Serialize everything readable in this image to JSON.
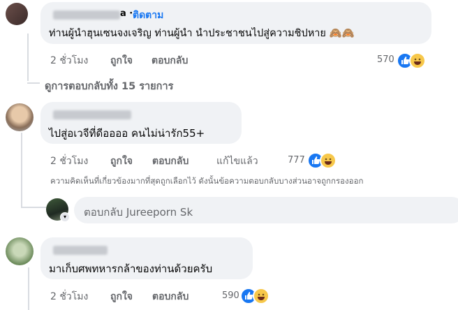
{
  "comments": [
    {
      "name_blurred": true,
      "follow_prefix": "a · ",
      "follow_label": "ติดตาม",
      "text": "ท่านผู้นำฮุนเซนจงเจริญ ท่านผู้นำ นำประชาชนไปสู่ความชิปหาย 🙈🙈",
      "time": "2 ชั่วโมง",
      "like": "ถูกใจ",
      "reply": "ตอบกลับ",
      "reaction_count": "570",
      "view_replies": "ดูการตอบกลับทั้ง 15 รายการ"
    },
    {
      "name_blurred": true,
      "text": "ไปสู่อเวจีที่ดีออออ คนไม่น่ารัก55+",
      "time": "2 ชั่วโมง",
      "like": "ถูกใจ",
      "reply": "ตอบกลับ",
      "edited": "แก้ไขแล้ว",
      "reaction_count": "777",
      "note": "ความคิดเห็นที่เกี่ยวข้องมากที่สุดถูกเลือกไว้ ดังนั้นข้อความตอบกลับบางส่วนอาจถูกกรองออก",
      "reply_box_placeholder": "ตอบกลับ Jureeporn Sk"
    },
    {
      "name_blurred": true,
      "text": "มาเก็บศพทหารกล้าของท่านด้วยครับ",
      "time": "2 ชั่วโมง",
      "like": "ถูกใจ",
      "reply": "ตอบกลับ",
      "reaction_count": "590"
    }
  ],
  "colors": {
    "link": "#1877f2",
    "bubble": "#f0f2f5",
    "secondary_text": "#65676b"
  },
  "icons": [
    "like-reaction-icon",
    "haha-reaction-icon"
  ]
}
